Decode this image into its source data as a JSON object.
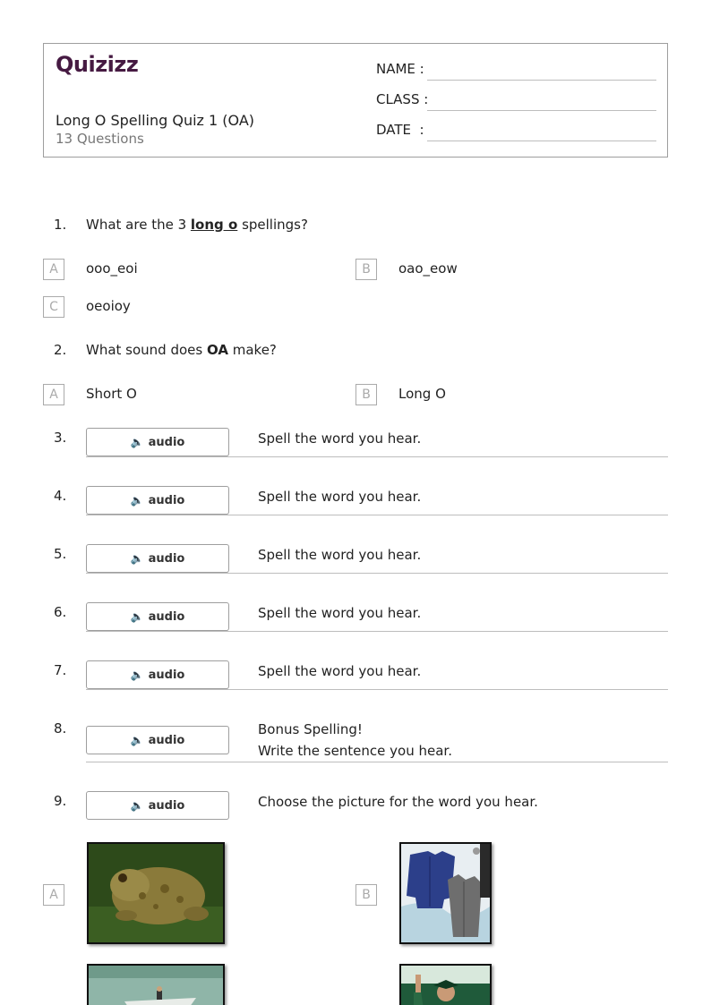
{
  "header": {
    "logo": "Quizizz",
    "title": "Long O Spelling Quiz 1 (OA)",
    "subtitle": "13 Questions",
    "fields": {
      "name": "NAME :",
      "class": "CLASS :",
      "date": "DATE  :"
    }
  },
  "questions": [
    {
      "number": "1.",
      "text_before": "What are the 3 ",
      "text_emph": "long o",
      "text_after": " spellings?",
      "options": [
        {
          "letter": "A",
          "text": "ooo_eoi"
        },
        {
          "letter": "B",
          "text": "oao_eow"
        },
        {
          "letter": "C",
          "text": "oeoioy"
        }
      ]
    },
    {
      "number": "2.",
      "text_before": "What sound does ",
      "text_emph": "OA",
      "text_after": " make?",
      "options": [
        {
          "letter": "A",
          "text": "Short O"
        },
        {
          "letter": "B",
          "text": "Long O"
        }
      ]
    },
    {
      "number": "3.",
      "button": "audio",
      "prompt": "Spell the word you hear."
    },
    {
      "number": "4.",
      "button": "audio",
      "prompt": "Spell the word you hear."
    },
    {
      "number": "5.",
      "button": "audio",
      "prompt": "Spell the word you hear."
    },
    {
      "number": "6.",
      "button": "audio",
      "prompt": "Spell the word you hear."
    },
    {
      "number": "7.",
      "button": "audio",
      "prompt": "Spell the word you hear."
    },
    {
      "number": "8.",
      "button": "audio",
      "prompt_line1": "Bonus Spelling!",
      "prompt_line2": "Write the sentence you hear."
    },
    {
      "number": "9.",
      "button": "audio",
      "prompt": "Choose the picture for the word you hear.",
      "options": [
        {
          "letter": "A",
          "image": "toad-photo"
        },
        {
          "letter": "B",
          "image": "coats-photo"
        }
      ]
    }
  ],
  "colors": {
    "brand": "#461a42",
    "border": "#9e9e9e",
    "option": "#aaaaaa"
  },
  "icons": {
    "audio": "speaker-icon"
  }
}
